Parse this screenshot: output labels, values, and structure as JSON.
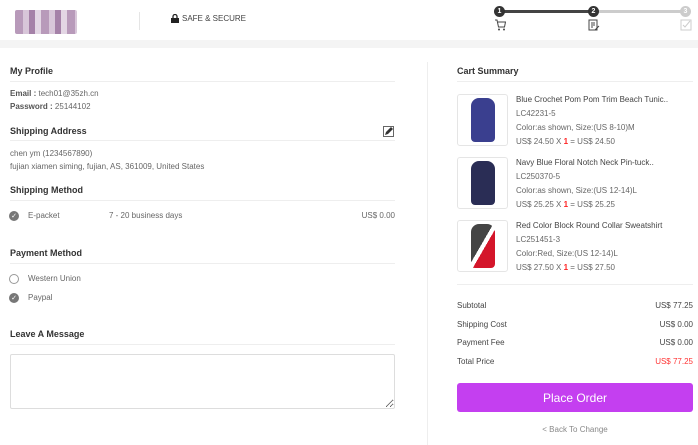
{
  "header": {
    "secure_label": "SAFE & SECURE",
    "steps": [
      "1",
      "2",
      "3"
    ]
  },
  "profile": {
    "title": "My Profile",
    "email_label": "Email :",
    "email": "tech01@35zh.cn",
    "password_label": "Password :",
    "password": "25144102"
  },
  "address": {
    "title": "Shipping Address",
    "name": "chen ym (1234567890)",
    "line": "fujian xiamen siming, fujian, AS, 361009, United States"
  },
  "shipping": {
    "title": "Shipping Method",
    "method": "E-packet",
    "days": "7 - 20 business days",
    "price": "US$ 0.00"
  },
  "payment": {
    "title": "Payment Method",
    "options": [
      {
        "label": "Western Union",
        "selected": false
      },
      {
        "label": "Paypal",
        "selected": true
      }
    ]
  },
  "message": {
    "title": "Leave A Message",
    "value": ""
  },
  "cart": {
    "title": "Cart Summary",
    "items": [
      {
        "name": "Blue Crochet Pom Pom Trim Beach Tunic..",
        "sku": "LC42231-5",
        "attrs": "Color:as shown, Size:(US 8-10)M",
        "price": "US$ 24.50 X ",
        "qty": "1",
        "total": " = US$ 24.50",
        "color": "#3a3f8f"
      },
      {
        "name": "Navy Blue Floral Notch Neck Pin-tuck..",
        "sku": "LC250370-5",
        "attrs": "Color:as shown, Size:(US 12-14)L",
        "price": "US$ 25.25 X ",
        "qty": "1",
        "total": " = US$ 25.25",
        "color": "#2a2d55"
      },
      {
        "name": "Red Color Block Round Collar Sweatshirt",
        "sku": "LC251451-3",
        "attrs": "Color:Red, Size:(US 12-14)L",
        "price": "US$ 27.50 X ",
        "qty": "1",
        "total": " = US$ 27.50",
        "color": "#d4152a"
      }
    ]
  },
  "totals": [
    {
      "label": "Subtotal",
      "value": "US$  77.25"
    },
    {
      "label": "Shipping Cost",
      "value": "US$  0.00"
    },
    {
      "label": "Payment Fee",
      "value": "US$  0.00"
    },
    {
      "label": "Total Price",
      "value": "US$  77.25"
    }
  ],
  "place_order": "Place Order",
  "back_link": "< Back To Change",
  "colors": {
    "accent": "#c43ff0",
    "total": "#f33"
  }
}
